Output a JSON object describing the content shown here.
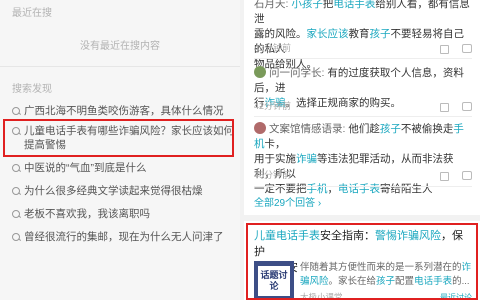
{
  "left": {
    "recent_header": "最近在搜",
    "recent_empty": "没有最近在搜内容",
    "discover_header": "搜索发现",
    "suggestions": [
      "广西北海不明鱼类咬伤游客，具体什么情况",
      "儿童电话手表有哪些诈骗风险？家长应该如何提高警惕",
      "中医说的“气血”到底是什么",
      "为什么很多经典文学读起来觉得很枯燥",
      "老板不喜欢我，我该离职吗",
      "曾经很流行的集邮，现在为什么无人问津了"
    ]
  },
  "right": {
    "comments": [
      {
        "line1": "石月天: 小孩子把电话手表给别人看，都有信息泄",
        "line2": "露的风险。家长应该教育孩子不要轻易将自己的私人",
        "line3": "物品给别人。",
        "time": "42分钟前"
      },
      {
        "author": "问一问学长",
        "line1": "问一问学长: 有的过度获取个人信息，资料后，进",
        "line2": "行诈骗。选择正规商家的购买。",
        "time": "42分钟前",
        "avatar_color": "#7a9a5a"
      },
      {
        "author": "文案馆情感语录",
        "line1": "文案馆情感语录: 他们趁孩子不被偷换走手机卡，",
        "line2": "用于实施诈骗等违法犯罪活动，从而非法获利，所以",
        "line3": "一定不要把手机，电话手表寄给陌生人",
        "time": "45分钟前",
        "avatar_color": "#b06a6a"
      }
    ],
    "all_comments": "全部29个回答",
    "article": {
      "title_part1": "儿童电话手表",
      "title_part2": "安全指南：",
      "title_part3": "警惕诈骗风险",
      "title_part4": "，保护",
      "title_part5": "孩子",
      "title_part6": "平安",
      "thumb_text": "话题讨论",
      "text1": "伴随着其方便性而来的是一系列潜在的诈",
      "text2": "骗风险。家长在给孩子配置电话手表的...",
      "source": "太极小课堂",
      "more": "最近讨论"
    }
  }
}
